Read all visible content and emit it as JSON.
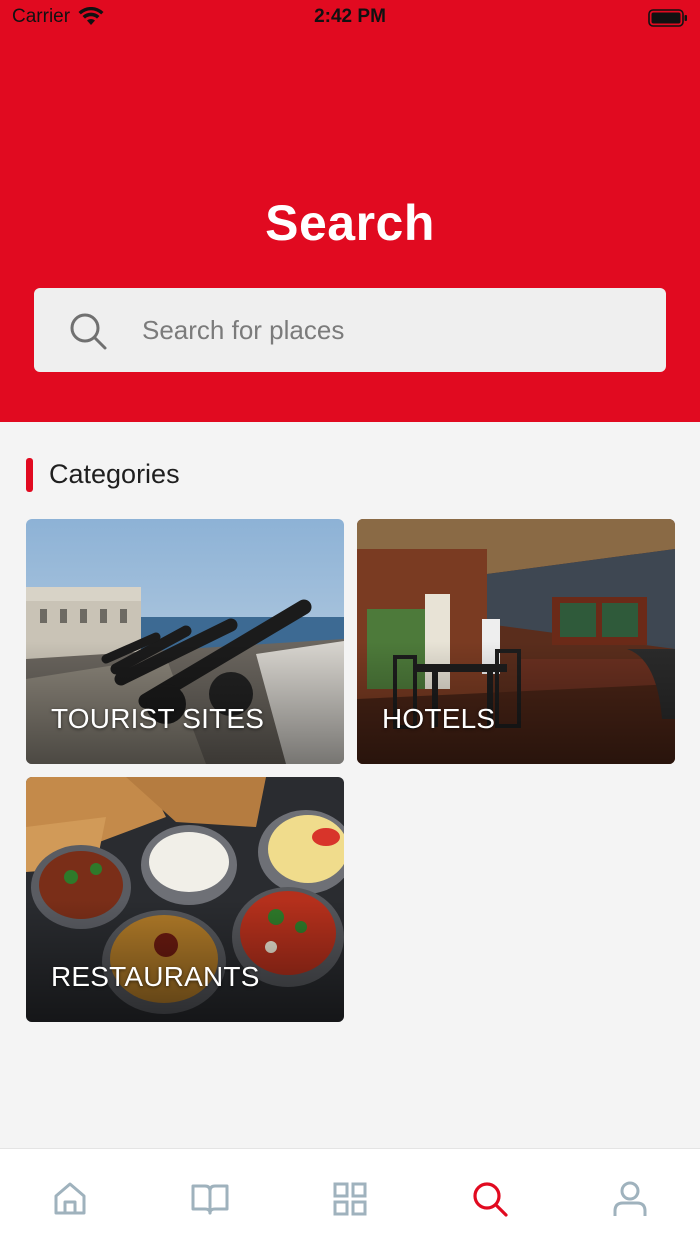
{
  "status_bar": {
    "carrier": "Carrier",
    "time": "2:42 PM",
    "wifi_icon": "wifi-icon",
    "battery_icon": "battery-icon"
  },
  "header": {
    "title": "Search",
    "background_color": "#e10a20"
  },
  "search": {
    "placeholder": "Search for places",
    "value": "",
    "icon": "search-icon"
  },
  "categories": {
    "title": "Categories",
    "items": [
      {
        "label": "TOURIST SITES",
        "image": "fort-cannons-photo"
      },
      {
        "label": "HOTELS",
        "image": "hotel-dining-room-photo"
      },
      {
        "label": "RESTAURANTS",
        "image": "indian-food-platter-photo"
      }
    ]
  },
  "tab_bar": {
    "active_color": "#e10a20",
    "inactive_color": "#9fb2bd",
    "tabs": [
      {
        "icon": "home-icon",
        "active": false
      },
      {
        "icon": "book-icon",
        "active": false
      },
      {
        "icon": "grid-icon",
        "active": false
      },
      {
        "icon": "search-icon",
        "active": true
      },
      {
        "icon": "user-icon",
        "active": false
      }
    ]
  }
}
